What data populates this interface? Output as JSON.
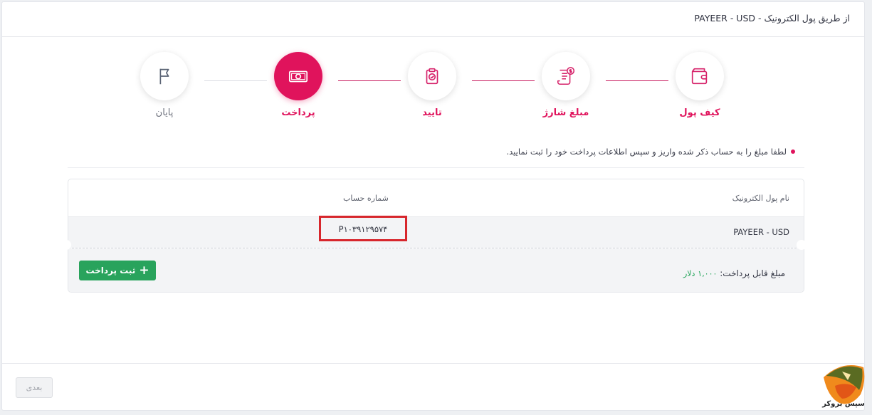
{
  "header": {
    "title": "از طریق پول الکترونیک - PAYEER - USD"
  },
  "steps": [
    {
      "label": "کیف پول",
      "icon": "wallet-icon",
      "state": "done"
    },
    {
      "label": "مبلغ شارژ",
      "icon": "invoice-dollar-icon",
      "state": "done"
    },
    {
      "label": "تایید",
      "icon": "clipboard-check-icon",
      "state": "done"
    },
    {
      "label": "پرداخت",
      "icon": "banknote-icon",
      "state": "active"
    },
    {
      "label": "پایان",
      "icon": "flag-icon",
      "state": "todo"
    }
  ],
  "note": "لطفا مبلغ را به حساب ذکر شده واریز و سپس اطلاعات پرداخت خود را ثبت نمایید.",
  "table": {
    "headers": {
      "wallet_name": "نام پول الکترونیک",
      "account_number": "شماره حساب"
    },
    "row": {
      "wallet_name": "PAYEER - USD",
      "account_number": "P۱۰۳۹۱۲۹۵۷۴"
    }
  },
  "payment": {
    "label": "مبلغ قابل پرداخت:",
    "amount": "۱,۰۰۰",
    "unit": "دلار"
  },
  "buttons": {
    "submit": "ثبت پرداخت",
    "next": "بعدی"
  },
  "logo": {
    "text": "سپس بروکر"
  },
  "colors": {
    "accent": "#e0135c",
    "success": "#29a35c",
    "highlight": "#d7262c"
  }
}
